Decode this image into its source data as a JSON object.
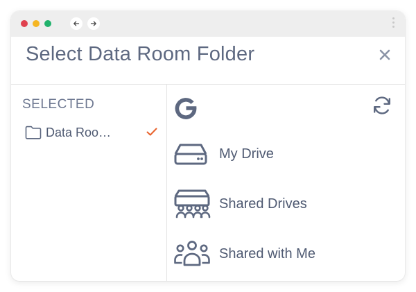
{
  "colors": {
    "close_dot": "#e0414f",
    "minimize_dot": "#f5b623",
    "zoom_dot": "#20b26c",
    "text": "#4f5a72",
    "icon": "#5d6880",
    "check": "#e8622c",
    "divider": "#e3e3e3"
  },
  "browser": {
    "back_icon": "arrow-left-icon",
    "forward_icon": "arrow-right-icon",
    "menu_icon": "kebab-menu-icon"
  },
  "dialog": {
    "title": "Select Data Room Folder",
    "close_icon": "close-icon"
  },
  "selected_panel": {
    "heading": "SELECTED",
    "items": [
      {
        "label": "Data Roo…",
        "icon": "folder-icon",
        "status_icon": "checkmark-icon"
      }
    ]
  },
  "source_panel": {
    "provider_icon": "google-icon",
    "refresh_icon": "refresh-icon",
    "items": [
      {
        "label": "My Drive",
        "icon": "hard-drive-icon"
      },
      {
        "label": "Shared Drives",
        "icon": "shared-drives-icon"
      },
      {
        "label": "Shared with Me",
        "icon": "people-group-icon"
      }
    ]
  }
}
